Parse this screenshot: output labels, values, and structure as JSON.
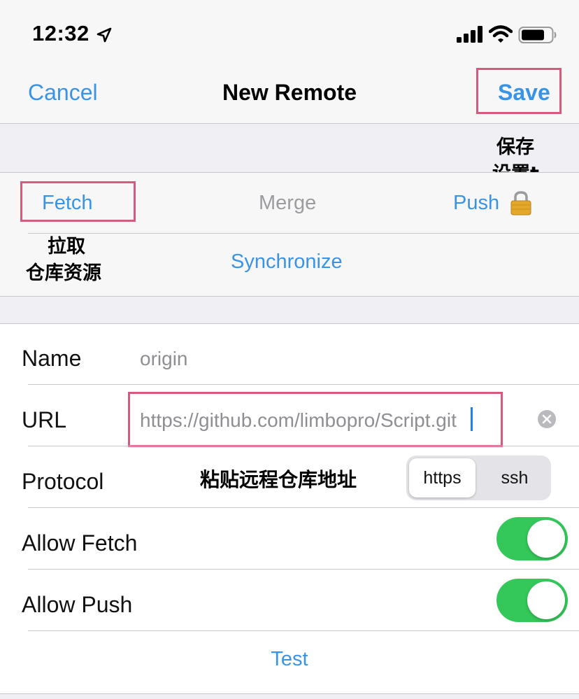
{
  "status_bar": {
    "time": "12:32",
    "icons": [
      "location-arrow-icon",
      "cellular-signal-icon",
      "wifi-icon",
      "battery-icon"
    ]
  },
  "nav": {
    "cancel_label": "Cancel",
    "title": "New Remote",
    "save_label": "Save"
  },
  "sync": {
    "fetch_label": "Fetch",
    "merge_label": "Merge",
    "push_label": "Push",
    "push_icon": "lock-icon",
    "synchronize_label": "Synchronize"
  },
  "annotations": {
    "save": [
      "保存",
      "设置t"
    ],
    "fetch": [
      "拉取",
      "仓库资源"
    ],
    "url": "粘贴远程仓库地址"
  },
  "form": {
    "name_label": "Name",
    "name_value": "origin",
    "url_label": "URL",
    "url_value": "https://github.com/limbopro/Script.git",
    "protocol_label": "Protocol",
    "protocol_options": [
      "https",
      "ssh"
    ],
    "protocol_selected": "https",
    "allow_fetch_label": "Allow Fetch",
    "allow_fetch_on": true,
    "allow_push_label": "Allow Push",
    "allow_push_on": true,
    "test_label": "Test"
  },
  "colors": {
    "accent": "#3a94e6",
    "toggle_on": "#34c759",
    "annotation_box": "#d35b7d"
  }
}
